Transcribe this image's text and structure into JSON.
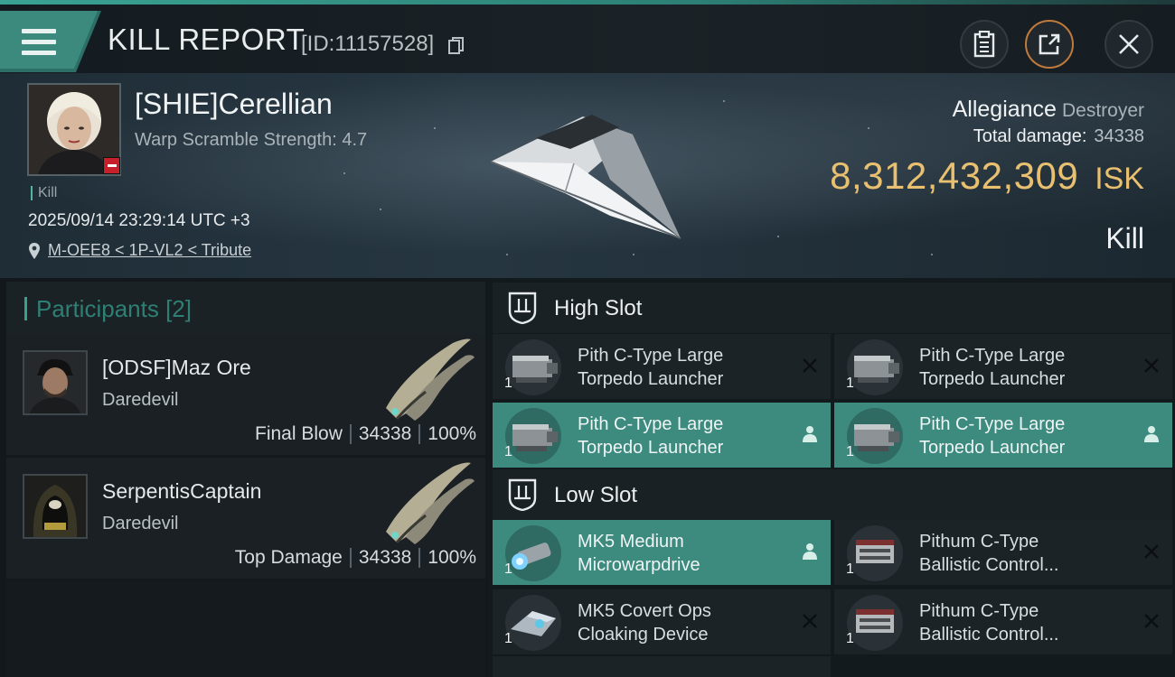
{
  "header": {
    "title": "KILL REPORT",
    "report_id": "[ID:11157528]"
  },
  "victim": {
    "name": "[SHIE]Cerellian",
    "warp_scramble": "Warp Scramble Strength: 4.7",
    "kill_tag": "Kill",
    "timestamp": "2025/09/14 23:29:14 UTC +3",
    "location": "M-OEE8 < 1P-VL2 < Tribute",
    "ship_name": "Allegiance",
    "ship_class": "Destroyer",
    "total_damage_label": "Total damage:",
    "total_damage": "34338",
    "isk_value": "8,312,432,309",
    "isk_unit": "ISK",
    "result": "Kill"
  },
  "participants": {
    "title": "Participants",
    "count": "[2]",
    "list": [
      {
        "name": "[ODSF]Maz Ore",
        "ship": "Daredevil",
        "role": "Final Blow",
        "damage": "34338",
        "percent": "100%"
      },
      {
        "name": "SerpentisCaptain",
        "ship": "Daredevil",
        "role": "Top Damage",
        "damage": "34338",
        "percent": "100%"
      }
    ]
  },
  "fitting": {
    "high_slot": {
      "title": "High Slot",
      "modules": [
        {
          "line1": "Pith C-Type Large",
          "line2": "Torpedo Launcher",
          "qty": "1",
          "status": "destroyed"
        },
        {
          "line1": "Pith C-Type Large",
          "line2": "Torpedo Launcher",
          "qty": "1",
          "status": "destroyed"
        },
        {
          "line1": "Pith C-Type Large",
          "line2": "Torpedo Launcher",
          "qty": "1",
          "status": "dropped"
        },
        {
          "line1": "Pith C-Type Large",
          "line2": "Torpedo Launcher",
          "qty": "1",
          "status": "dropped"
        }
      ]
    },
    "low_slot": {
      "title": "Low Slot",
      "modules": [
        {
          "line1": "MK5 Medium",
          "line2": "Microwarpdrive",
          "qty": "1",
          "status": "dropped"
        },
        {
          "line1": "Pithum C-Type",
          "line2": "Ballistic Control...",
          "qty": "1",
          "status": "destroyed"
        },
        {
          "line1": "MK5 Covert Ops",
          "line2": "Cloaking Device",
          "qty": "1",
          "status": "destroyed"
        },
        {
          "line1": "Pithum C-Type",
          "line2": "Ballistic Control...",
          "qty": "1",
          "status": "destroyed"
        }
      ]
    }
  },
  "icons": {
    "menu": "hamburger-menu-icon",
    "copy": "copy-icon",
    "clipboard": "clipboard-icon",
    "share": "share-icon",
    "close": "close-icon",
    "location": "location-pin-icon",
    "destroyed": "close-x-icon",
    "dropped": "person-icon"
  },
  "colors": {
    "accent": "#3d8a7e",
    "isk": "#e8c070",
    "share_ring": "#c07a3a",
    "negative_standing": "#c8202a"
  }
}
